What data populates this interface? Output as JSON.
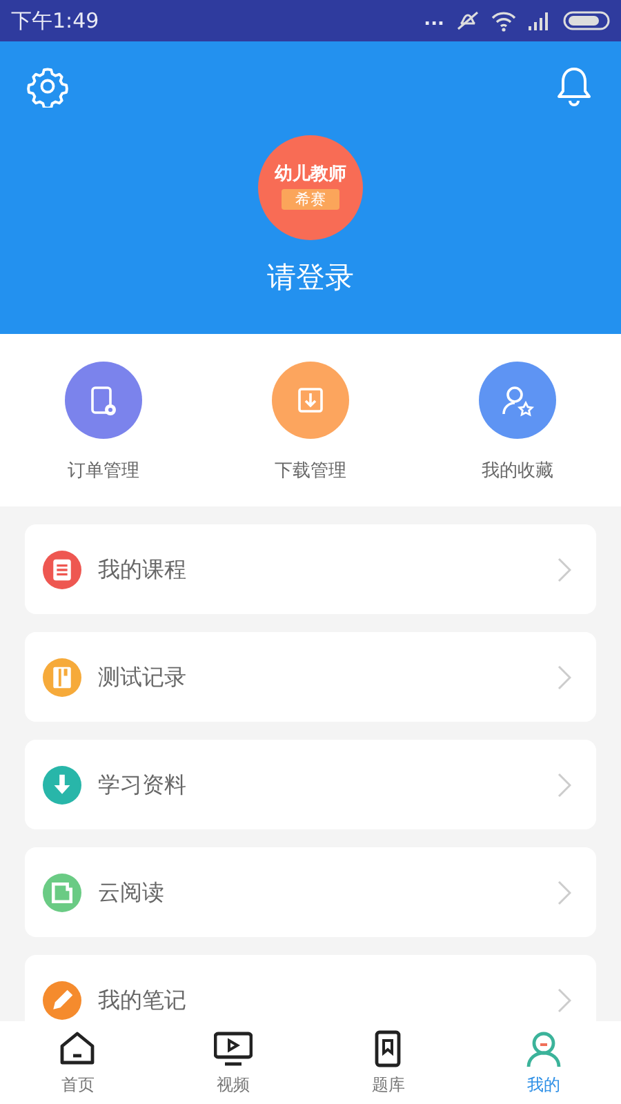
{
  "status_bar": {
    "time": "下午1:49",
    "more": "..."
  },
  "header": {
    "logo_title": "幼儿教师",
    "logo_badge": "希赛",
    "login": "请登录"
  },
  "quick_actions": [
    {
      "kind": "orders",
      "label": "订单管理"
    },
    {
      "kind": "downloads",
      "label": "下载管理"
    },
    {
      "kind": "favorites",
      "label": "我的收藏"
    }
  ],
  "menu": [
    {
      "kind": "courses",
      "label": "我的课程"
    },
    {
      "kind": "tests",
      "label": "测试记录"
    },
    {
      "kind": "materials",
      "label": "学习资料"
    },
    {
      "kind": "reading",
      "label": "云阅读"
    },
    {
      "kind": "notes",
      "label": "我的笔记"
    }
  ],
  "tabs": [
    {
      "kind": "home",
      "label": "首页",
      "selected": false
    },
    {
      "kind": "video",
      "label": "视频",
      "selected": false
    },
    {
      "kind": "questions",
      "label": "题库",
      "selected": false
    },
    {
      "kind": "me",
      "label": "我的",
      "selected": true
    }
  ]
}
